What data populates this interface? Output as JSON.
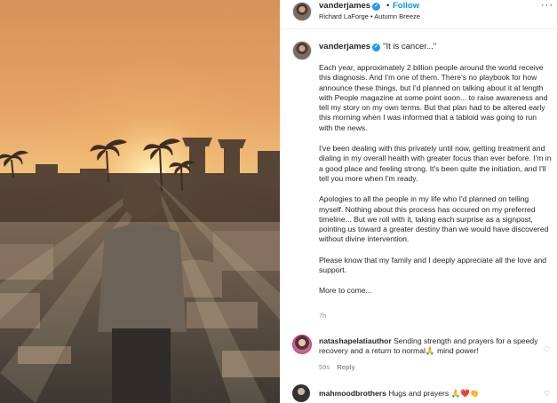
{
  "header": {
    "username": "vanderjames",
    "separator": "•",
    "follow_label": "Follow",
    "music": "Richard LaForge • Autumn Breeze",
    "more_label": "···"
  },
  "caption": {
    "username": "vanderjames",
    "title": "\"It is cancer...\"",
    "paragraphs": [
      "Each year, approximately 2 billion people around the world receive this diagnosis. And I'm one of them. There's no playbook for how announce these things, but I'd planned on talking about it at length with People magazine at some point soon... to raise awareness and tell my story on my own terms. But that plan had to be altered early this morning when I was informed that a tabloid was going to run with the news.",
      "I've been dealing with this privately until now, getting treatment and dialing in my overall health with greater focus than ever before. I'm in a good place and feeling strong. It's been quite the initiation, and I'll tell you more when I'm ready.",
      "Apologies to all the people in my life who I'd planned on telling myself. Nothing about this process has occured on my preferred timeline... But we roll with it, taking each surprise as a signpost, pointing us toward a greater destiny than we would have discovered without divine intervention.",
      "Please know that my family and I deeply appreciate all the love and support.",
      "More to come..."
    ],
    "time": "7h"
  },
  "comments": [
    {
      "username": "natashapelatiauthor",
      "text": "Sending strength and prayers for a speedy recovery and a return to normal🙏 mind power!",
      "time": "59s",
      "reply_label": "Reply"
    },
    {
      "username": "mahmoodbrothers",
      "text": "Hugs and prayers 🙏❤️👏",
      "time": "",
      "reply_label": ""
    }
  ],
  "icons": {
    "verified": "verified-badge-icon",
    "heart": "heart-icon"
  },
  "colors": {
    "follow": "#0095f6",
    "verified": "#1d9bf0",
    "muted": "#8e8e8e"
  }
}
